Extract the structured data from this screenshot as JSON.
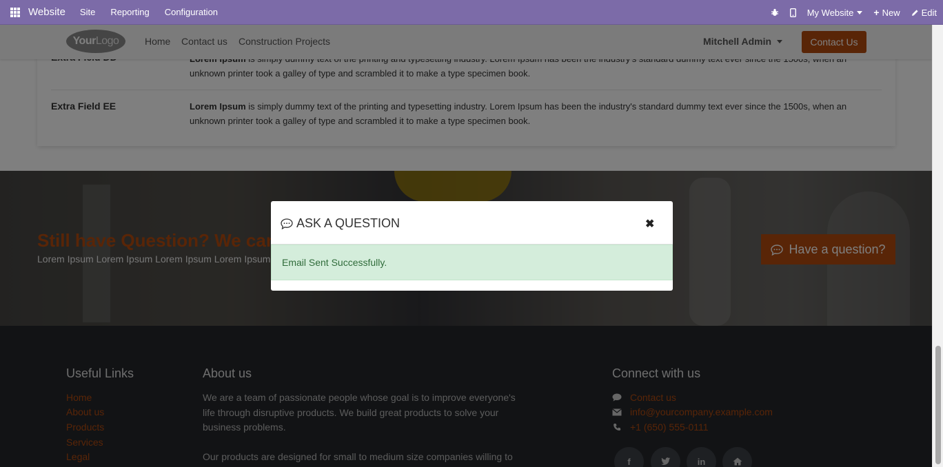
{
  "topbar": {
    "brand": "Website",
    "menus": [
      "Site",
      "Reporting",
      "Configuration"
    ],
    "my_website": "My Website",
    "new_label": "New",
    "edit_label": "Edit"
  },
  "header": {
    "logo_text_bold": "Your",
    "logo_text_light": "Logo",
    "nav": [
      "Home",
      "Contact us",
      "Construction Projects"
    ],
    "user": "Mitchell Admin",
    "contact_button": "Contact Us"
  },
  "fields": [
    {
      "label": "Extra Field DD",
      "bold": "Lorem Ipsum",
      "text": " is simply dummy text of the printing and typesetting industry. Lorem Ipsum has been the industry's standard dummy text ever since the 1500s, when an unknown printer took a galley of type and scrambled it to make a type specimen book."
    },
    {
      "label": "Extra Field EE",
      "bold": "Lorem Ipsum",
      "text": " is simply dummy text of the printing and typesetting industry. Lorem Ipsum has been the industry's standard dummy text ever since the 1500s, when an unknown printer took a galley of type and scrambled it to make a type specimen book."
    }
  ],
  "banner": {
    "title": "Still have Question? We can",
    "subtitle": "Lorem Ipsum Lorem Ipsum Lorem Ipsum Lorem Ipsum",
    "button": "Have a question?"
  },
  "modal": {
    "title": "ASK A QUESTION",
    "close": "✖",
    "alert": "Email Sent Successfully."
  },
  "footer": {
    "useful_links_title": "Useful Links",
    "useful_links": [
      "Home",
      "About us",
      "Products",
      "Services",
      "Legal"
    ],
    "about_title": "About us",
    "about_p1": "We are a team of passionate people whose goal is to improve everyone's life through disruptive products. We build great products to solve your business problems.",
    "about_p2": "Our products are designed for small to medium size companies willing to",
    "connect_title": "Connect with us",
    "contact_us": "Contact us",
    "email": "info@yourcompany.example.com",
    "phone": "+1 (650) 555-0111",
    "social": [
      "f",
      "t",
      "in",
      "home"
    ]
  },
  "colors": {
    "odoo_purple": "#7c6ba8",
    "accent": "#b24a0f",
    "footer_bg": "#24272b",
    "success_bg": "#d4eddb"
  }
}
